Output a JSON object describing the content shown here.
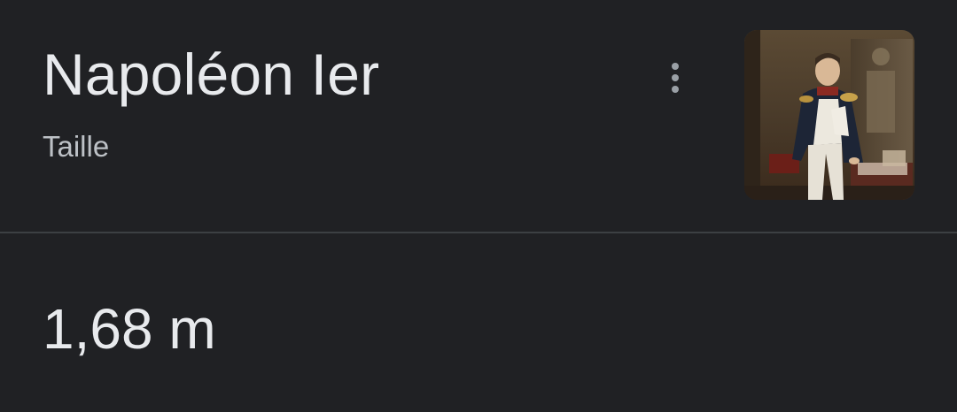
{
  "entity": {
    "title": "Napoléon Ier",
    "attribute_label": "Taille"
  },
  "answer": {
    "value": "1,68 m"
  },
  "thumbnail": {
    "subject": "portrait-painting"
  },
  "menu": {
    "icon": "more-vert-icon"
  },
  "colors": {
    "background": "#202124",
    "title_text": "#e8eaed",
    "secondary_text": "#bdc1c6",
    "divider": "#3c4043",
    "icon": "#9aa0a6"
  }
}
